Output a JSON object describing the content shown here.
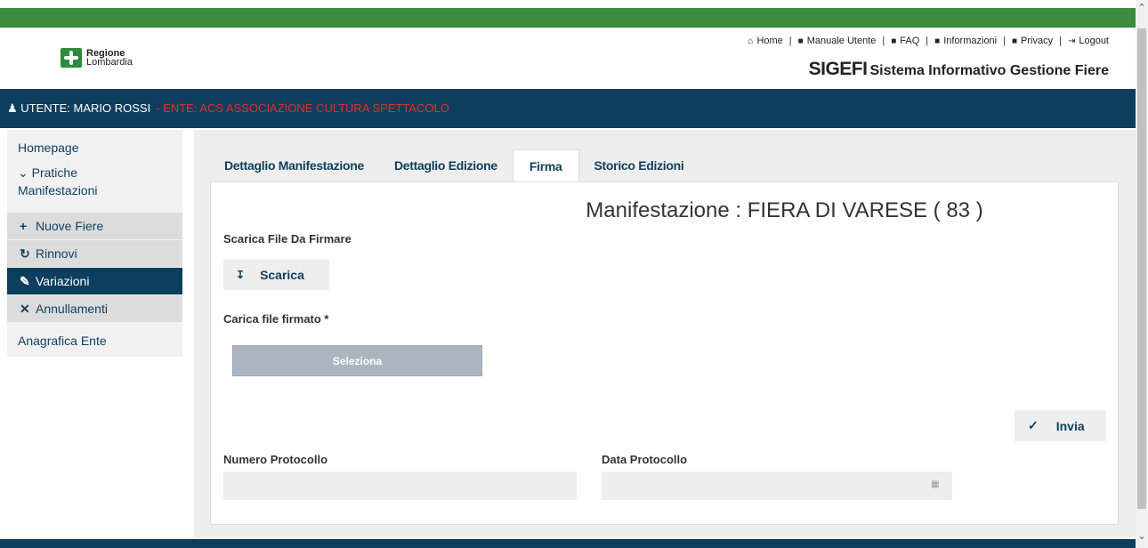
{
  "header": {
    "logo": {
      "line1": "Regione",
      "line2": "Lombardia"
    },
    "links": [
      {
        "icon": "home-icon",
        "glyph": "⌂",
        "label": "Home"
      },
      {
        "icon": "document-icon",
        "glyph": "■",
        "label": "Manuale Utente"
      },
      {
        "icon": "book-icon",
        "glyph": "■",
        "label": "FAQ"
      },
      {
        "icon": "document-icon",
        "glyph": "■",
        "label": "Informazioni"
      },
      {
        "icon": "document-icon",
        "glyph": "■",
        "label": "Privacy"
      },
      {
        "icon": "logout-icon",
        "glyph": "⇥",
        "label": "Logout"
      }
    ],
    "app_short": "SIGEFI",
    "app_long": "Sistema Informativo Gestione Fiere"
  },
  "userbar": {
    "user": "UTENTE: MARIO ROSSI",
    "ente": "- ENTE: ACS ASSOCIAZIONE CULTURA SPETTACOLO"
  },
  "sidebar": {
    "homepage": "Homepage",
    "pratiche_line1": "Pratiche",
    "pratiche_line2": "Manifestazioni",
    "subitems": [
      {
        "icon": "plus-icon",
        "glyph": "+",
        "label": "Nuove Fiere"
      },
      {
        "icon": "refresh-icon",
        "glyph": "↻",
        "label": "Rinnovi"
      },
      {
        "icon": "pencil-icon",
        "glyph": "✎",
        "label": "Variazioni"
      },
      {
        "icon": "trash-icon",
        "glyph": "✕",
        "label": "Annullamenti"
      }
    ],
    "anagrafica": "Anagrafica Ente"
  },
  "tabs": [
    {
      "label": "Dettaglio Manifestazione"
    },
    {
      "label": "Dettaglio Edizione"
    },
    {
      "label": "Firma"
    },
    {
      "label": "Storico Edizioni"
    }
  ],
  "main": {
    "title": "Manifestazione : FIERA DI VARESE ( 83 )",
    "scarica_label": "Scarica File Da Firmare",
    "scarica_btn": "Scarica",
    "carica_label": "Carica file firmato *",
    "seleziona_btn": "Seleziona",
    "invia_btn": "Invia",
    "numero_label": "Numero Protocollo",
    "numero_value": "",
    "data_label": "Data Protocollo",
    "data_value": ""
  },
  "colors": {
    "brand_green": "#3b8a3e",
    "navy": "#0e3e5e",
    "ente_red": "#e0302a"
  }
}
